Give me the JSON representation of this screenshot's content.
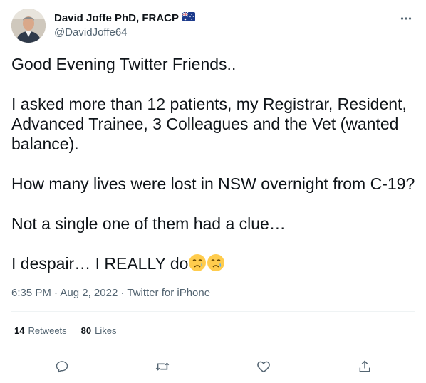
{
  "author": {
    "display_name": "David Joffe PhD, FRACP",
    "handle": "@DavidJoffe64",
    "flag_icon": "australia-flag-icon"
  },
  "tweet": {
    "paragraphs": [
      "Good Evening Twitter Friends..",
      "I asked more than 12 patients, my Registrar, Resident, Advanced Trainee, 3 Colleagues and the Vet (wanted balance).",
      "How many lives were lost in NSW overnight from C-19?",
      "Not a single one of them had a clue…"
    ],
    "last_line": "I despair… I REALLY do",
    "emojis": [
      "crying-face-emoji",
      "crying-face-emoji"
    ]
  },
  "meta": {
    "time": "6:35 PM",
    "date": "Aug 2, 2022",
    "source": "Twitter for iPhone",
    "separator": " · "
  },
  "stats": {
    "retweets_count": "14",
    "retweets_label": "Retweets",
    "likes_count": "80",
    "likes_label": "Likes"
  },
  "actions": [
    "reply-icon",
    "retweet-icon",
    "like-icon",
    "share-icon"
  ],
  "colors": {
    "text": "#0f1419",
    "secondary": "#536471",
    "divider": "#eff3f4"
  }
}
